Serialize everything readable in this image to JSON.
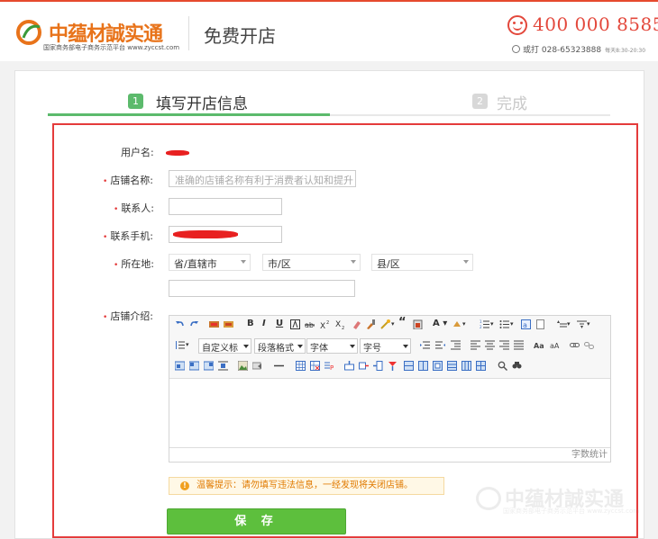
{
  "header": {
    "logo_name": "中蕴材誠实通",
    "logo_sub": "国家商务部电子商务示范平台 www.zyccst.com",
    "title": "免费开店",
    "hotline": "400 000 8585",
    "alt_phone": "或打 028-65323888",
    "hours": "每天8:30-20:30"
  },
  "steps": [
    {
      "num": "1",
      "label": "填写开店信息",
      "active": true
    },
    {
      "num": "2",
      "label": "完成",
      "active": false
    }
  ],
  "form": {
    "username_label": "用户名:",
    "store_name_label": "店铺名称:",
    "store_name_placeholder": "准确的店铺名称有利于消费者认知和提升",
    "contact_label": "联系人:",
    "contact_value": "",
    "phone_label": "联系手机:",
    "location_label": "所在地:",
    "province": "省/直辖市",
    "city": "市/区",
    "county": "县/区",
    "address_value": "",
    "intro_label": "店铺介绍:",
    "required_mark": "•"
  },
  "editor": {
    "custom_title": "自定义标",
    "paragraph_format": "段落格式",
    "font": "字体",
    "font_size": "字号",
    "word_count": "字数统计"
  },
  "tip": {
    "text": "温馨提示：请勿填写违法信息，一经发现将关闭店铺。"
  },
  "save_label": "保 存",
  "watermark": {
    "name": "中蕴材誠实通",
    "sub": "国家商务部电子商务示范平台 www.zyccst.com"
  },
  "colors": {
    "brand_orange": "#e8731a",
    "hotline_red": "#e3483c",
    "step_green": "#5cba6c",
    "save_green": "#5dbf3d",
    "highlight_red": "#e43b3b"
  }
}
